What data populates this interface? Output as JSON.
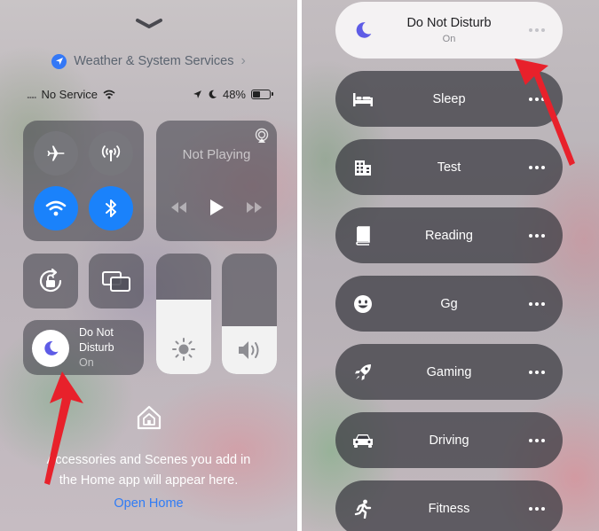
{
  "left_panel": {
    "location_banner": {
      "label": "Weather & System Services",
      "icon": "location-arrow-icon"
    },
    "status_bar": {
      "carrier": "No Service",
      "battery": "48%",
      "battery_level": 0.48
    },
    "connectivity": {
      "airplane": "airplane-icon",
      "cellular": "cellular-icon",
      "wifi": "wifi-icon",
      "bluetooth": "bluetooth-icon"
    },
    "media": {
      "now_playing": "Not Playing"
    },
    "brightness_level": 0.62,
    "volume_level": 0.4,
    "focus_tile": {
      "title_line1": "Do Not",
      "title_line2": "Disturb",
      "status": "On"
    },
    "home": {
      "message_line1": "Accessories and Scenes you add in",
      "message_line2": "the Home app will appear here.",
      "open_label": "Open Home"
    },
    "accent_blue": "#1a82fb",
    "arrow_color": "#e8212b"
  },
  "right_panel": {
    "focus_modes": [
      {
        "label": "Do Not Disturb",
        "status": "On",
        "icon": "moon-icon",
        "active": true
      },
      {
        "label": "Sleep",
        "icon": "bed-icon",
        "active": false
      },
      {
        "label": "Test",
        "icon": "building-icon",
        "active": false
      },
      {
        "label": "Reading",
        "icon": "book-icon",
        "active": false
      },
      {
        "label": "Gg",
        "icon": "smiley-icon",
        "active": false
      },
      {
        "label": "Gaming",
        "icon": "rocket-icon",
        "active": false
      },
      {
        "label": "Driving",
        "icon": "car-icon",
        "active": false
      },
      {
        "label": "Fitness",
        "icon": "runner-icon",
        "active": false
      }
    ]
  }
}
